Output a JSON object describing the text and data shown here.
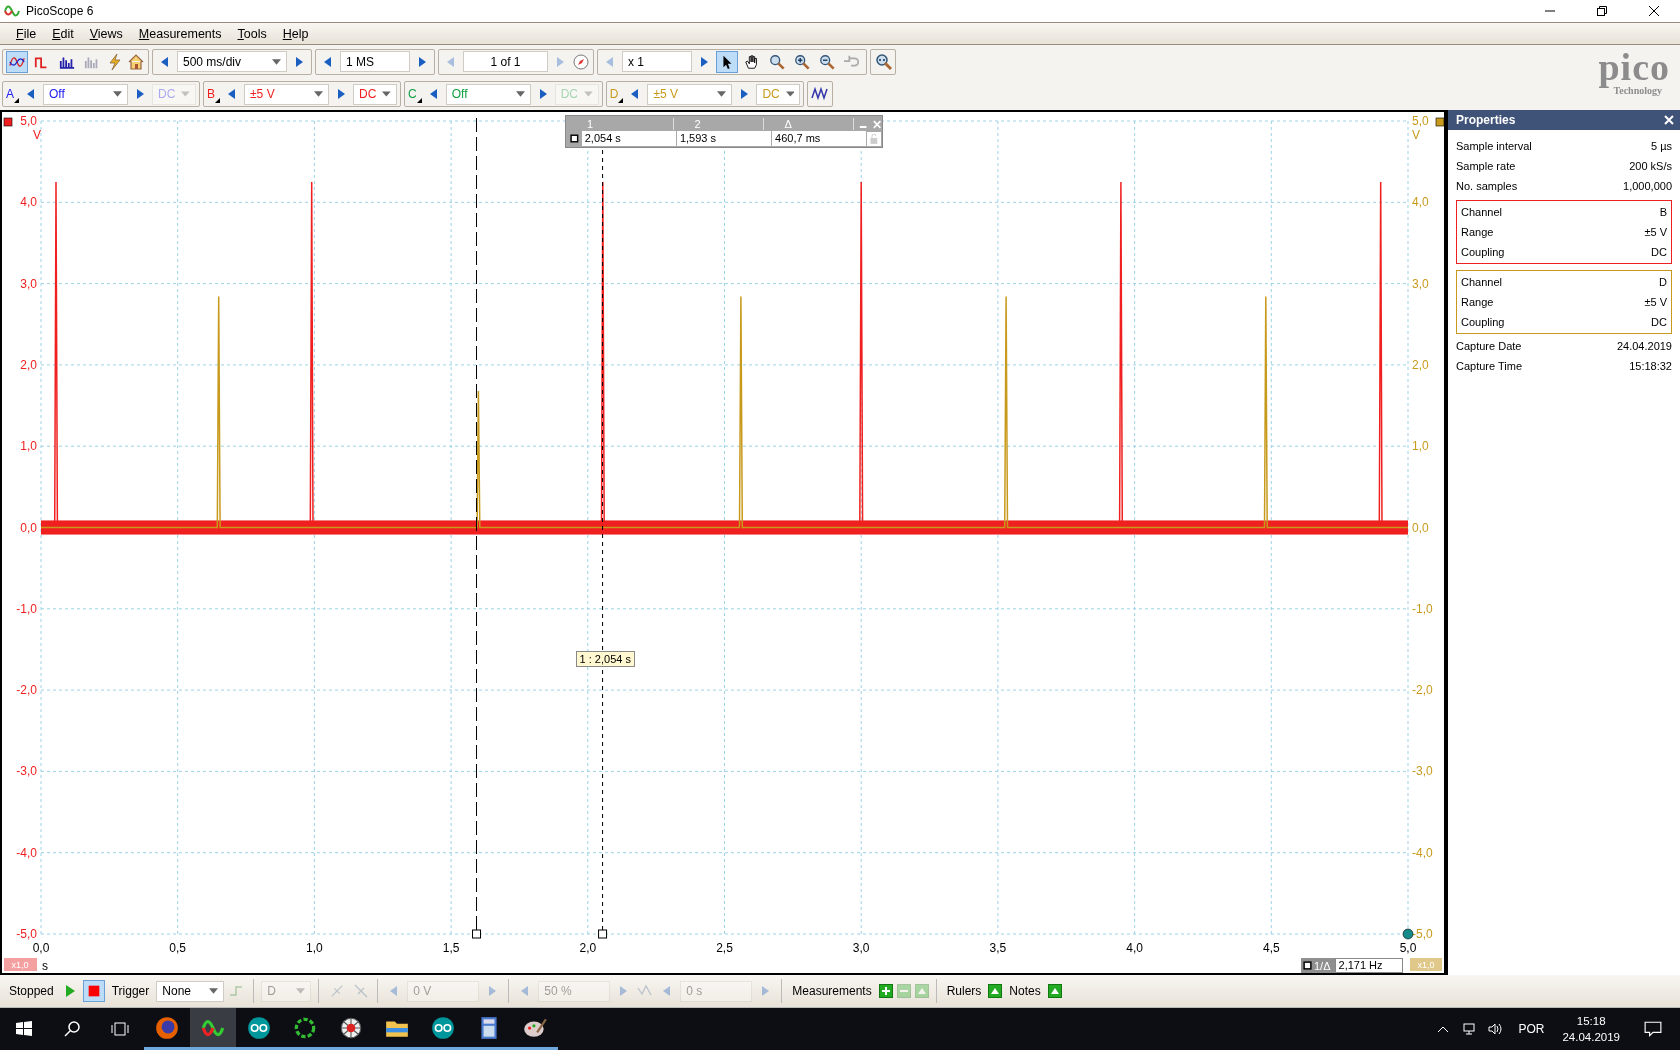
{
  "window": {
    "title": "PicoScope 6"
  },
  "menu": [
    {
      "label": "File"
    },
    {
      "label": "Edit"
    },
    {
      "label": "Views"
    },
    {
      "label": "Measurements"
    },
    {
      "label": "Tools"
    },
    {
      "label": "Help"
    }
  ],
  "view_modes": [
    {
      "kind": "scope",
      "selected": true
    },
    {
      "kind": "persistence",
      "selected": false
    },
    {
      "kind": "spectrum",
      "selected": false
    },
    {
      "kind": "spectrum-off",
      "selected": false
    }
  ],
  "timebase": "500 ms/div",
  "samples": "1 MS",
  "buffer": {
    "value": "1 of 1",
    "enabled": false
  },
  "zoom_factor": "x 1",
  "tools": [
    {
      "kind": "pointer",
      "selected": true
    },
    {
      "kind": "hand",
      "selected": false
    },
    {
      "kind": "zoom",
      "selected": false
    },
    {
      "kind": "zoom-in",
      "selected": false
    },
    {
      "kind": "zoom-out",
      "selected": false
    },
    {
      "kind": "undo",
      "selected": false
    }
  ],
  "logo": {
    "name": "pico",
    "tagline": "Technology"
  },
  "channels": [
    {
      "letter": "A",
      "color": "#2020f0",
      "range": "Off",
      "coupling": "DC",
      "enabled": false
    },
    {
      "letter": "B",
      "color": "#f02020",
      "range": "±5 V",
      "coupling": "DC",
      "enabled": true
    },
    {
      "letter": "C",
      "color": "#10a040",
      "range": "Off",
      "coupling": "DC",
      "enabled": false
    },
    {
      "letter": "D",
      "color": "#c89a1c",
      "range": "±5 V",
      "coupling": "DC",
      "enabled": true
    }
  ],
  "cursor_table": {
    "headers": [
      "1",
      "2",
      "Δ"
    ],
    "values": [
      "2,054 s",
      "1,593 s",
      "460,7 ms"
    ]
  },
  "cursor_tooltip": "1 : 2,054 s",
  "plot": {
    "left_unit": "V",
    "right_unit": "V",
    "x_unit": "s",
    "left_scale": "x1,0",
    "right_scale": "x1,0",
    "frequency_label": "1/Δ",
    "frequency": "2,171 Hz",
    "right_ticks": [
      "5,0",
      "4,0",
      "3,0",
      "2,0",
      "1,0",
      "0,0",
      "-1,0",
      "-2,0",
      "-3,0",
      "-4,0",
      "-5,0"
    ],
    "chart_data": {
      "type": "line",
      "xlim": [
        0,
        5
      ],
      "ylim": [
        -5,
        5
      ],
      "grid": true,
      "ref_lines": [
        {
          "axis": "x",
          "value": 2.054
        },
        {
          "axis": "x",
          "value": 1.593
        }
      ],
      "bands": [
        {
          "axis": "y",
          "from": -0.05,
          "to": 0.05,
          "color": "#f02020"
        }
      ],
      "xticks": [
        {
          "value": 0,
          "label": "0,0"
        },
        {
          "value": 0.5,
          "label": "0,5"
        },
        {
          "value": 1,
          "label": "1,0"
        },
        {
          "value": 1.5,
          "label": "1,5"
        },
        {
          "value": 2,
          "label": "2,0"
        },
        {
          "value": 2.5,
          "label": "2,5"
        },
        {
          "value": 3,
          "label": "3,0"
        },
        {
          "value": 3.5,
          "label": "3,5"
        },
        {
          "value": 4,
          "label": "4,0"
        },
        {
          "value": 4.5,
          "label": "4,5"
        },
        {
          "value": 5,
          "label": "5,0"
        }
      ],
      "yticks": [
        {
          "value": 5,
          "label": "5,0"
        },
        {
          "value": 4,
          "label": "4,0"
        },
        {
          "value": 3,
          "label": "3,0"
        },
        {
          "value": 2,
          "label": "2,0"
        },
        {
          "value": 1,
          "label": "1,0"
        },
        {
          "value": 0,
          "label": "0,0"
        },
        {
          "value": -1,
          "label": "-1,0"
        },
        {
          "value": -2,
          "label": "-2,0"
        },
        {
          "value": -3,
          "label": "-3,0"
        },
        {
          "value": -4,
          "label": "-4,0"
        },
        {
          "value": -5,
          "label": "-5,0"
        }
      ],
      "x": [
        0,
        0.05,
        0.055,
        0.06,
        0.645,
        0.65,
        0.655,
        0.985,
        0.99,
        0.995,
        1.595,
        1.6,
        1.605,
        2.05,
        2.055,
        2.06,
        2.555,
        2.56,
        2.565,
        2.995,
        3.0,
        3.005,
        3.525,
        3.53,
        3.535,
        3.945,
        3.95,
        3.955,
        4.475,
        4.48,
        4.485,
        4.895,
        4.9,
        4.905,
        5
      ],
      "series": [
        {
          "color": "#f02020",
          "values": [
            0,
            0,
            4.25,
            0,
            0,
            0,
            0,
            0,
            4.25,
            0,
            0,
            0,
            0,
            0,
            4.25,
            0,
            0,
            0,
            0,
            0,
            4.25,
            0,
            0,
            0,
            0,
            0,
            4.25,
            0,
            0,
            0,
            0,
            0,
            4.25,
            0,
            0
          ]
        },
        {
          "color": "#c89a1c",
          "values": [
            0,
            0,
            0,
            0,
            0,
            2.84,
            0,
            0,
            0,
            0,
            0,
            1.68,
            0,
            0,
            0,
            0,
            0,
            2.84,
            0,
            0,
            0,
            0,
            0,
            2.84,
            0,
            0,
            0,
            0,
            0,
            2.84,
            0,
            0,
            0,
            0,
            0
          ]
        }
      ]
    }
  },
  "properties": {
    "title": "Properties",
    "rows": [
      {
        "label": "Sample interval",
        "value": "5 µs"
      },
      {
        "label": "Sample rate",
        "value": "200 kS/s"
      },
      {
        "label": "No. samples",
        "value": "1,000,000"
      }
    ],
    "groups": [
      {
        "color": "#f02020",
        "rows": [
          {
            "label": "Channel",
            "value": "B"
          },
          {
            "label": "Range",
            "value": "±5 V"
          },
          {
            "label": "Coupling",
            "value": "DC"
          }
        ]
      },
      {
        "color": "#c89a1c",
        "rows": [
          {
            "label": "Channel",
            "value": "D"
          },
          {
            "label": "Range",
            "value": "±5 V"
          },
          {
            "label": "Coupling",
            "value": "DC"
          }
        ]
      }
    ],
    "footer_rows": [
      {
        "label": "Capture Date",
        "value": "24.04.2019"
      },
      {
        "label": "Capture Time",
        "value": "15:18:32"
      }
    ]
  },
  "status_bar": {
    "state": "Stopped",
    "running": false,
    "trigger_label": "Trigger",
    "trigger_mode": "None",
    "trigger_channel": "D",
    "threshold": "0 V",
    "pre_trigger": "50 %",
    "delay": "0 s",
    "measurements": "Measurements",
    "rulers": "Rulers",
    "notes": "Notes"
  },
  "taskbar": {
    "apps": [
      {
        "kind": "firefox",
        "selected": false
      },
      {
        "kind": "scope",
        "selected": true
      },
      {
        "kind": "ide",
        "selected": false
      },
      {
        "kind": "ring",
        "selected": false
      },
      {
        "kind": "web",
        "selected": false
      },
      {
        "kind": "folder",
        "selected": false
      },
      {
        "kind": "ide",
        "selected": false
      },
      {
        "kind": "calculator",
        "selected": false
      },
      {
        "kind": "paint",
        "selected": false
      }
    ],
    "language": "POR",
    "time": "15:18",
    "date": "24.04.2019"
  }
}
